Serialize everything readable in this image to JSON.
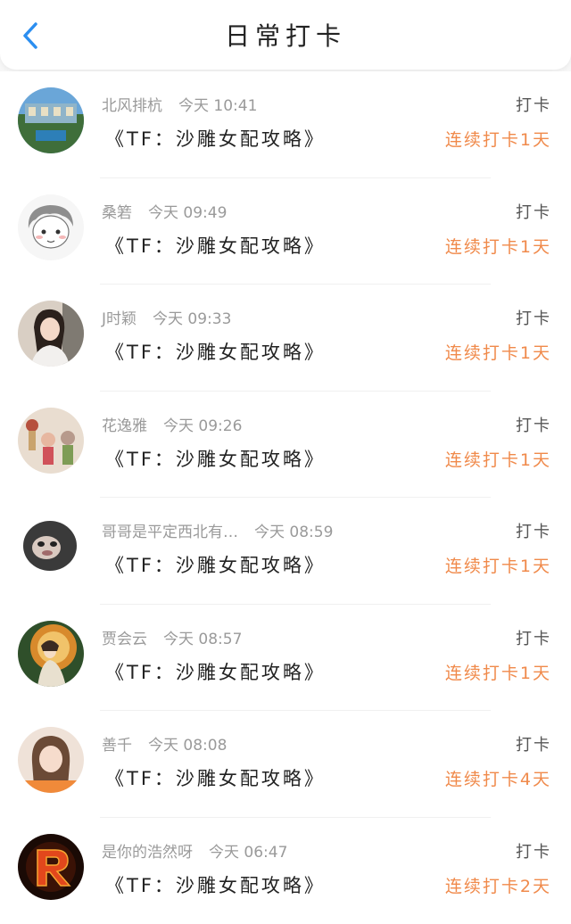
{
  "header": {
    "title": "日常打卡",
    "back_icon": "chevron-left-icon",
    "accent_color": "#2b8ef0"
  },
  "streak_color": "#f08a4b",
  "entries": [
    {
      "user": "北风排杭",
      "time": "今天 10:41",
      "action": "打卡",
      "book": "《TF：沙雕女配攻略》",
      "streak": "连续打卡1天",
      "avatar_icon": "landscape-avatar"
    },
    {
      "user": "桑箬",
      "time": "今天 09:49",
      "action": "打卡",
      "book": "《TF：沙雕女配攻略》",
      "streak": "连续打卡1天",
      "avatar_icon": "sketch-avatar"
    },
    {
      "user": "J时颖",
      "time": "今天 09:33",
      "action": "打卡",
      "book": "《TF：沙雕女配攻略》",
      "streak": "连续打卡1天",
      "avatar_icon": "photo-avatar"
    },
    {
      "user": "花逸雅",
      "time": "今天 09:26",
      "action": "打卡",
      "book": "《TF：沙雕女配攻略》",
      "streak": "连续打卡1天",
      "avatar_icon": "dolls-avatar"
    },
    {
      "user": "哥哥是平定西北有…",
      "time": "今天 08:59",
      "action": "打卡",
      "book": "《TF：沙雕女配攻略》",
      "streak": "连续打卡1天",
      "avatar_icon": "meme-avatar"
    },
    {
      "user": "贾会云",
      "time": "今天 08:57",
      "action": "打卡",
      "book": "《TF：沙雕女配攻略》",
      "streak": "连续打卡1天",
      "avatar_icon": "painting-avatar"
    },
    {
      "user": "善千",
      "time": "今天 08:08",
      "action": "打卡",
      "book": "《TF：沙雕女配攻略》",
      "streak": "连续打卡4天",
      "avatar_icon": "girl-avatar"
    },
    {
      "user": "是你的浩然呀",
      "time": "今天 06:47",
      "action": "打卡",
      "book": "《TF：沙雕女配攻略》",
      "streak": "连续打卡2天",
      "avatar_icon": "letter-r-avatar"
    }
  ]
}
